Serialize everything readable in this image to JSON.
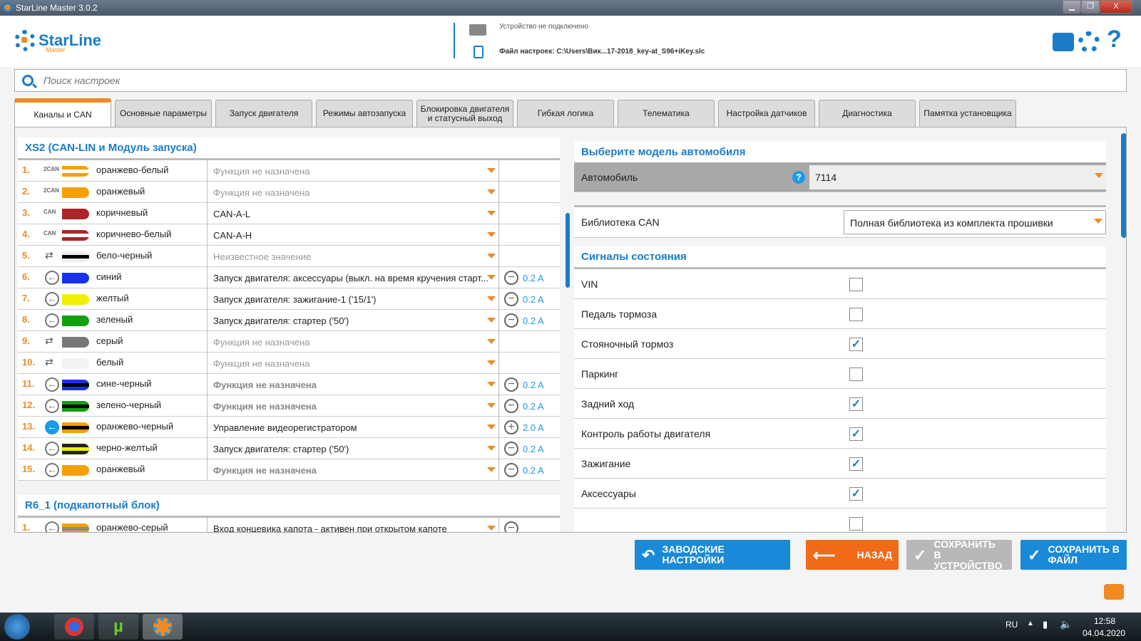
{
  "window": {
    "title": "StarLine Master 3.0.2",
    "min": "▁",
    "max": "❐",
    "close": "X"
  },
  "header": {
    "logo": "StarLine",
    "logo_sub": "Master",
    "device_status": "Устройство не подключено",
    "settings_file": "Файл настроек: C:\\Users\\Вик...17-2018_key-at_S96+iKey.slc",
    "icons": [
      "printer-icon",
      "gear-icon",
      "help-icon"
    ]
  },
  "search": {
    "placeholder": "Поиск настроек"
  },
  "tabs": [
    {
      "label": "Каналы и CAN",
      "active": true
    },
    {
      "label": "Основные параметры"
    },
    {
      "label": "Запуск двигателя"
    },
    {
      "label": "Режимы автозапуска"
    },
    {
      "label": "Блокировка двигателя и статусный выход"
    },
    {
      "label": "Гибкая логика"
    },
    {
      "label": "Телематика"
    },
    {
      "label": "Настройка датчиков"
    },
    {
      "label": "Диагностика"
    },
    {
      "label": "Памятка установщика"
    }
  ],
  "left": {
    "section1": "XS2 (CAN-LIN и Модуль запуска)",
    "rows": [
      {
        "n": "1.",
        "type": "2CAN",
        "kind": "can",
        "colors": [
          "#f5a000",
          "#fff"
        ],
        "name": "оранжево-белый",
        "value": "Функция не назначена",
        "style": "dim"
      },
      {
        "n": "2.",
        "type": "2CAN",
        "kind": "can",
        "colors": [
          "#f5a000"
        ],
        "name": "оранжевый",
        "value": "Функция не назначена",
        "style": "dim"
      },
      {
        "n": "3.",
        "type": "CAN",
        "kind": "can",
        "colors": [
          "#a8262a"
        ],
        "name": "коричневый",
        "value": "CAN-A-L",
        "style": ""
      },
      {
        "n": "4.",
        "type": "CAN",
        "kind": "can",
        "colors": [
          "#a8262a",
          "#fff"
        ],
        "name": "коричнево-белый",
        "value": "CAN-A-H",
        "style": ""
      },
      {
        "n": "5.",
        "type": "",
        "kind": "io",
        "colors": [
          "#eee",
          "#000"
        ],
        "name": "бело-черный",
        "value": "Неизвестное значение",
        "style": "dim"
      },
      {
        "n": "6.",
        "type": "",
        "kind": "out",
        "colors": [
          "#1a30f0"
        ],
        "name": "синий",
        "value": "Запуск двигателя: аксессуары (выкл. на время кручения старт...",
        "style": "",
        "sign": "−",
        "current": "0.2 A"
      },
      {
        "n": "7.",
        "type": "",
        "kind": "out",
        "colors": [
          "#f0f000"
        ],
        "name": "желтый",
        "value": "Запуск двигателя: зажигание-1 ('15/1')",
        "style": "",
        "sign": "−",
        "current": "0.2 A"
      },
      {
        "n": "8.",
        "type": "",
        "kind": "out",
        "colors": [
          "#10a010"
        ],
        "name": "зеленый",
        "value": "Запуск двигателя: стартер ('50')",
        "style": "",
        "sign": "−",
        "current": "0.2 A"
      },
      {
        "n": "9.",
        "type": "",
        "kind": "io",
        "colors": [
          "#777"
        ],
        "name": "серый",
        "value": "Функция не назначена",
        "style": "dim"
      },
      {
        "n": "10.",
        "type": "",
        "kind": "io",
        "colors": [
          "#f2f2f2"
        ],
        "name": "белый",
        "value": "Функция не назначена",
        "style": "dim"
      },
      {
        "n": "11.",
        "type": "",
        "kind": "out",
        "colors": [
          "#1a30f0",
          "#000"
        ],
        "name": "сине-черный",
        "value": "Функция не назначена",
        "style": "bold",
        "sign": "−",
        "current": "0.2 A"
      },
      {
        "n": "12.",
        "type": "",
        "kind": "out",
        "colors": [
          "#10a010",
          "#000"
        ],
        "name": "зелено-черный",
        "value": "Функция не назначена",
        "style": "bold",
        "sign": "−",
        "current": "0.2 A"
      },
      {
        "n": "13.",
        "type": "",
        "kind": "outblue",
        "colors": [
          "#f5a000",
          "#000"
        ],
        "name": "оранжево-черный",
        "value": "Управление видеорегистратором",
        "style": "",
        "sign": "+",
        "current": "2.0 A"
      },
      {
        "n": "14.",
        "type": "",
        "kind": "out",
        "colors": [
          "#222",
          "#f0f000"
        ],
        "name": "черно-желтый",
        "value": "Запуск двигателя: стартер ('50')",
        "style": "",
        "sign": "−",
        "current": "0.2 A"
      },
      {
        "n": "15.",
        "type": "",
        "kind": "out",
        "colors": [
          "#f5a000"
        ],
        "name": "оранжевый",
        "value": "Функция не назначена",
        "style": "bold",
        "sign": "−",
        "current": "0.2 A"
      }
    ],
    "section2": "R6_1 (подкапотный блок)",
    "rows2": [
      {
        "n": "1.",
        "type": "",
        "kind": "out",
        "colors": [
          "#f5a000",
          "#888"
        ],
        "name": "оранжево-серый",
        "value": "Вход концевика капота - активен при открытом капоте",
        "style": "",
        "sign": "−",
        "current": ""
      }
    ]
  },
  "right": {
    "car_heading": "Выберите модель автомобиля",
    "car_label": "Автомобиль",
    "car_help": "?",
    "car_value": "7114",
    "can_label": "Библиотека CAN",
    "can_value": "Полная библиотека из комплекта прошивки",
    "signals_heading": "Сигналы состояния",
    "signals": [
      {
        "label": "VIN",
        "checked": false
      },
      {
        "label": "Педаль тормоза",
        "checked": false
      },
      {
        "label": "Стояночный тормоз",
        "checked": true
      },
      {
        "label": "Паркинг",
        "checked": false
      },
      {
        "label": "Задний ход",
        "checked": true
      },
      {
        "label": "Контроль работы двигателя",
        "checked": true
      },
      {
        "label": "Зажигание",
        "checked": true
      },
      {
        "label": "Аксессуары",
        "checked": true
      }
    ]
  },
  "buttons": {
    "factory": "ЗАВОДСКИЕ НАСТРОЙКИ",
    "back": "НАЗАД",
    "save_device": "СОХРАНИТЬ В УСТРОЙСТВО",
    "save_file": "СОХРАНИТЬ В ФАЙЛ"
  },
  "colors": {
    "accent": "#1a7cc9",
    "orange": "#f08a24",
    "disabled": "#b8b8b8"
  },
  "taskbar": {
    "lang": "RU",
    "time": "12:58",
    "date": "04.04.2020"
  }
}
